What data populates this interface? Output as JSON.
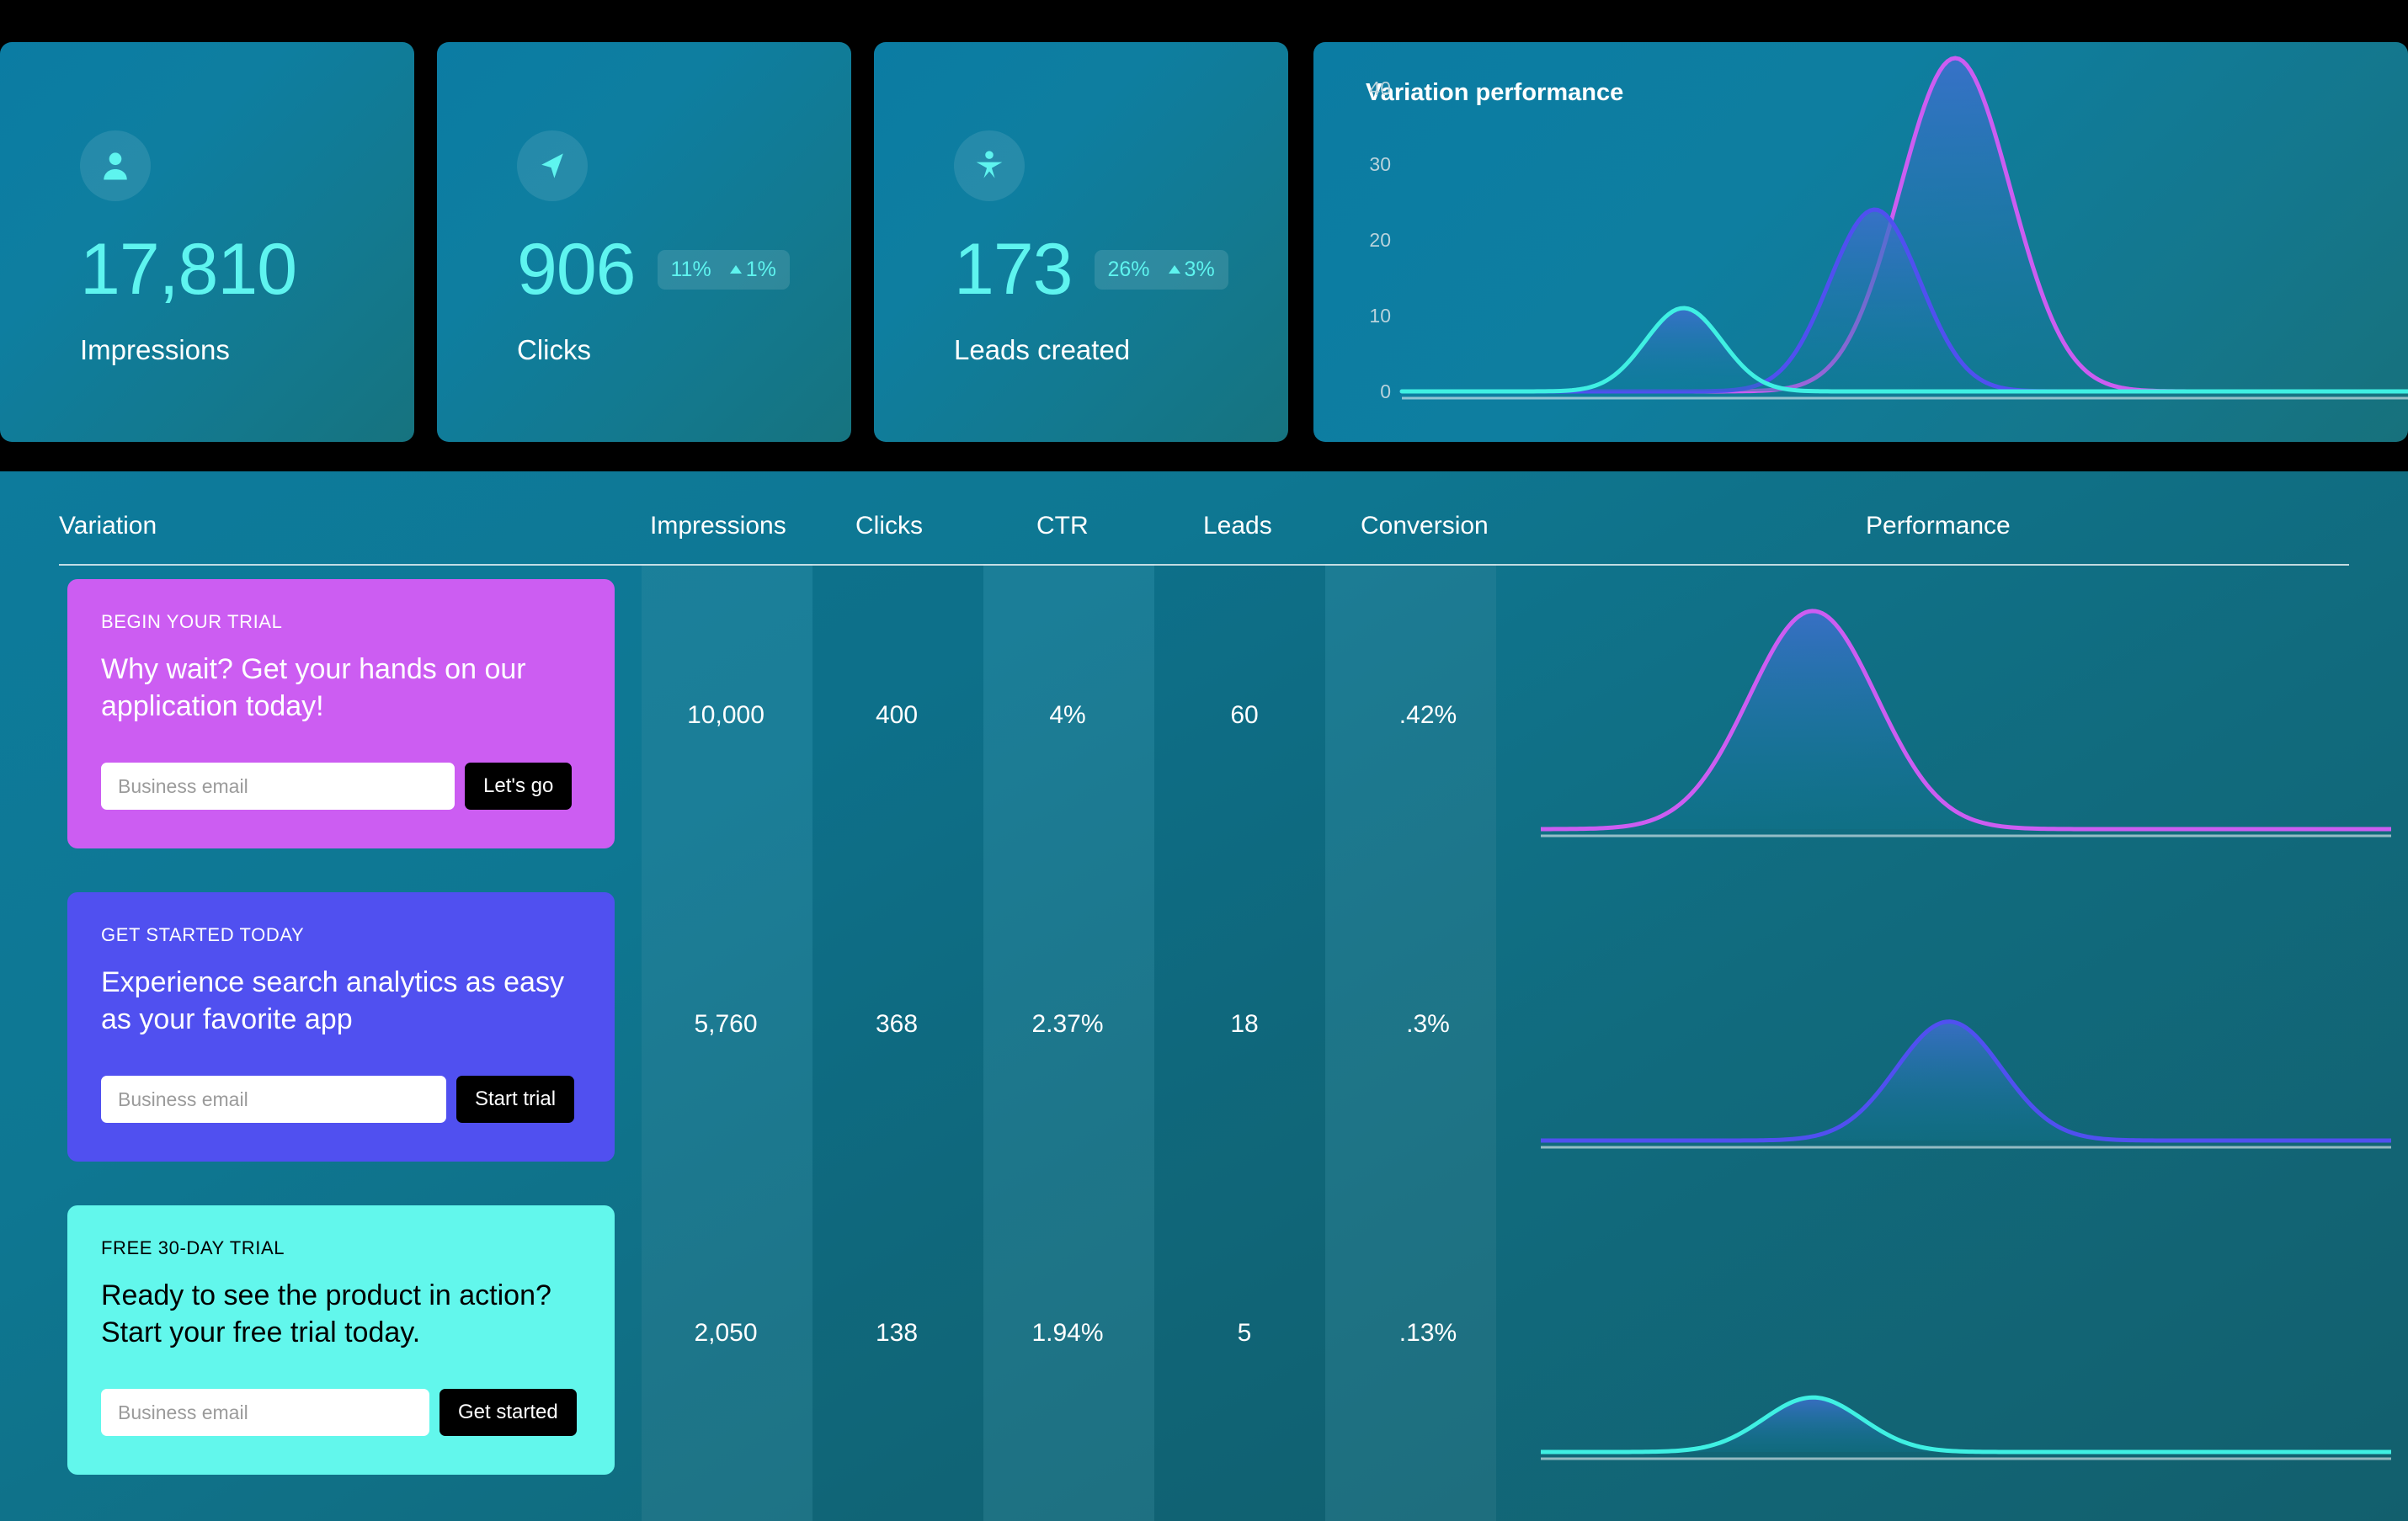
{
  "theme": {
    "page_bg": "#000000",
    "card_bg_start": "#0b7ca3",
    "card_bg_end": "#16737f",
    "accent_cyan": "#5ef4ef",
    "variation_1_color": "#cc5df2",
    "variation_2_color": "#5050f0",
    "variation_3_color": "#62f7ec"
  },
  "stats": [
    {
      "icon": "person-icon",
      "value": "17,810",
      "label": "Impressions",
      "badge": null
    },
    {
      "icon": "cursor-pointer-icon",
      "value": "906",
      "label": "Clicks",
      "badge": {
        "percent": "11%",
        "delta": "1%",
        "direction": "up"
      }
    },
    {
      "icon": "person-star-icon",
      "value": "173",
      "label": "Leads created",
      "badge": {
        "percent": "26%",
        "delta": "3%",
        "direction": "up"
      }
    }
  ],
  "performance_panel": {
    "title": "Variation performance"
  },
  "table": {
    "headers": [
      "Variation",
      "Impressions",
      "Clicks",
      "CTR",
      "Leads",
      "Conversion",
      "Performance"
    ],
    "rows": [
      {
        "variation": {
          "eyebrow": "BEGIN YOUR TRIAL",
          "headline": "Why wait? Get your hands on our application today!",
          "email_placeholder": "Business email",
          "email_value": "",
          "cta_label": "Let's go",
          "color": "#cc5df2"
        },
        "impressions": "10,000",
        "clicks": "400",
        "ctr": "4%",
        "leads": "60",
        "conversion": ".42%"
      },
      {
        "variation": {
          "eyebrow": "GET STARTED TODAY",
          "headline": "Experience search analytics as easy as your favorite app",
          "email_placeholder": "Business email",
          "email_value": "",
          "cta_label": "Start trial",
          "color": "#5050f0"
        },
        "impressions": "5,760",
        "clicks": "368",
        "ctr": "2.37%",
        "leads": "18",
        "conversion": ".3%"
      },
      {
        "variation": {
          "eyebrow": "FREE 30-DAY TRIAL",
          "headline": "Ready to see the product in action? Start your free trial today.",
          "email_placeholder": "Business email",
          "email_value": "",
          "cta_label": "Get started",
          "color": "#62f7ec"
        },
        "impressions": "2,050",
        "clicks": "138",
        "ctr": "1.94%",
        "leads": "5",
        "conversion": ".13%"
      }
    ]
  },
  "chart_data": [
    {
      "type": "line",
      "name": "variation-performance-overview",
      "title": "Variation performance",
      "xlabel": "",
      "ylabel": "",
      "ylim": [
        0,
        45
      ],
      "yticks": [
        0,
        10,
        20,
        30,
        40
      ],
      "ytick_labels": [
        "0",
        "10",
        "20",
        "30",
        "40"
      ],
      "grid": false,
      "legend": "none",
      "series": [
        {
          "name": "Variation 1",
          "color": "#cc5df2",
          "peak_x": 0.55,
          "peak_y": 44,
          "sigma": 0.055,
          "filled": true
        },
        {
          "name": "Variation 2",
          "color": "#5050f0",
          "peak_x": 0.47,
          "peak_y": 24,
          "sigma": 0.045,
          "filled": true
        },
        {
          "name": "Variation 3",
          "color": "#3ff0e3",
          "peak_x": 0.28,
          "peak_y": 11,
          "sigma": 0.038,
          "filled": true
        }
      ]
    },
    {
      "type": "line",
      "name": "row-1-performance",
      "title": "",
      "ylim": [
        0,
        45
      ],
      "grid": false,
      "legend": "none",
      "series": [
        {
          "name": "Variation 1",
          "color": "#cc5df2",
          "peak_x": 0.32,
          "peak_y": 44,
          "sigma": 0.075,
          "filled": true
        }
      ]
    },
    {
      "type": "line",
      "name": "row-2-performance",
      "title": "",
      "ylim": [
        0,
        45
      ],
      "grid": false,
      "legend": "none",
      "series": [
        {
          "name": "Variation 2",
          "color": "#5050f0",
          "peak_x": 0.48,
          "peak_y": 24,
          "sigma": 0.062,
          "filled": true
        }
      ]
    },
    {
      "type": "line",
      "name": "row-3-performance",
      "title": "",
      "ylim": [
        0,
        45
      ],
      "grid": false,
      "legend": "none",
      "series": [
        {
          "name": "Variation 3",
          "color": "#3ff0e3",
          "peak_x": 0.32,
          "peak_y": 11,
          "sigma": 0.058,
          "filled": true
        }
      ]
    }
  ]
}
